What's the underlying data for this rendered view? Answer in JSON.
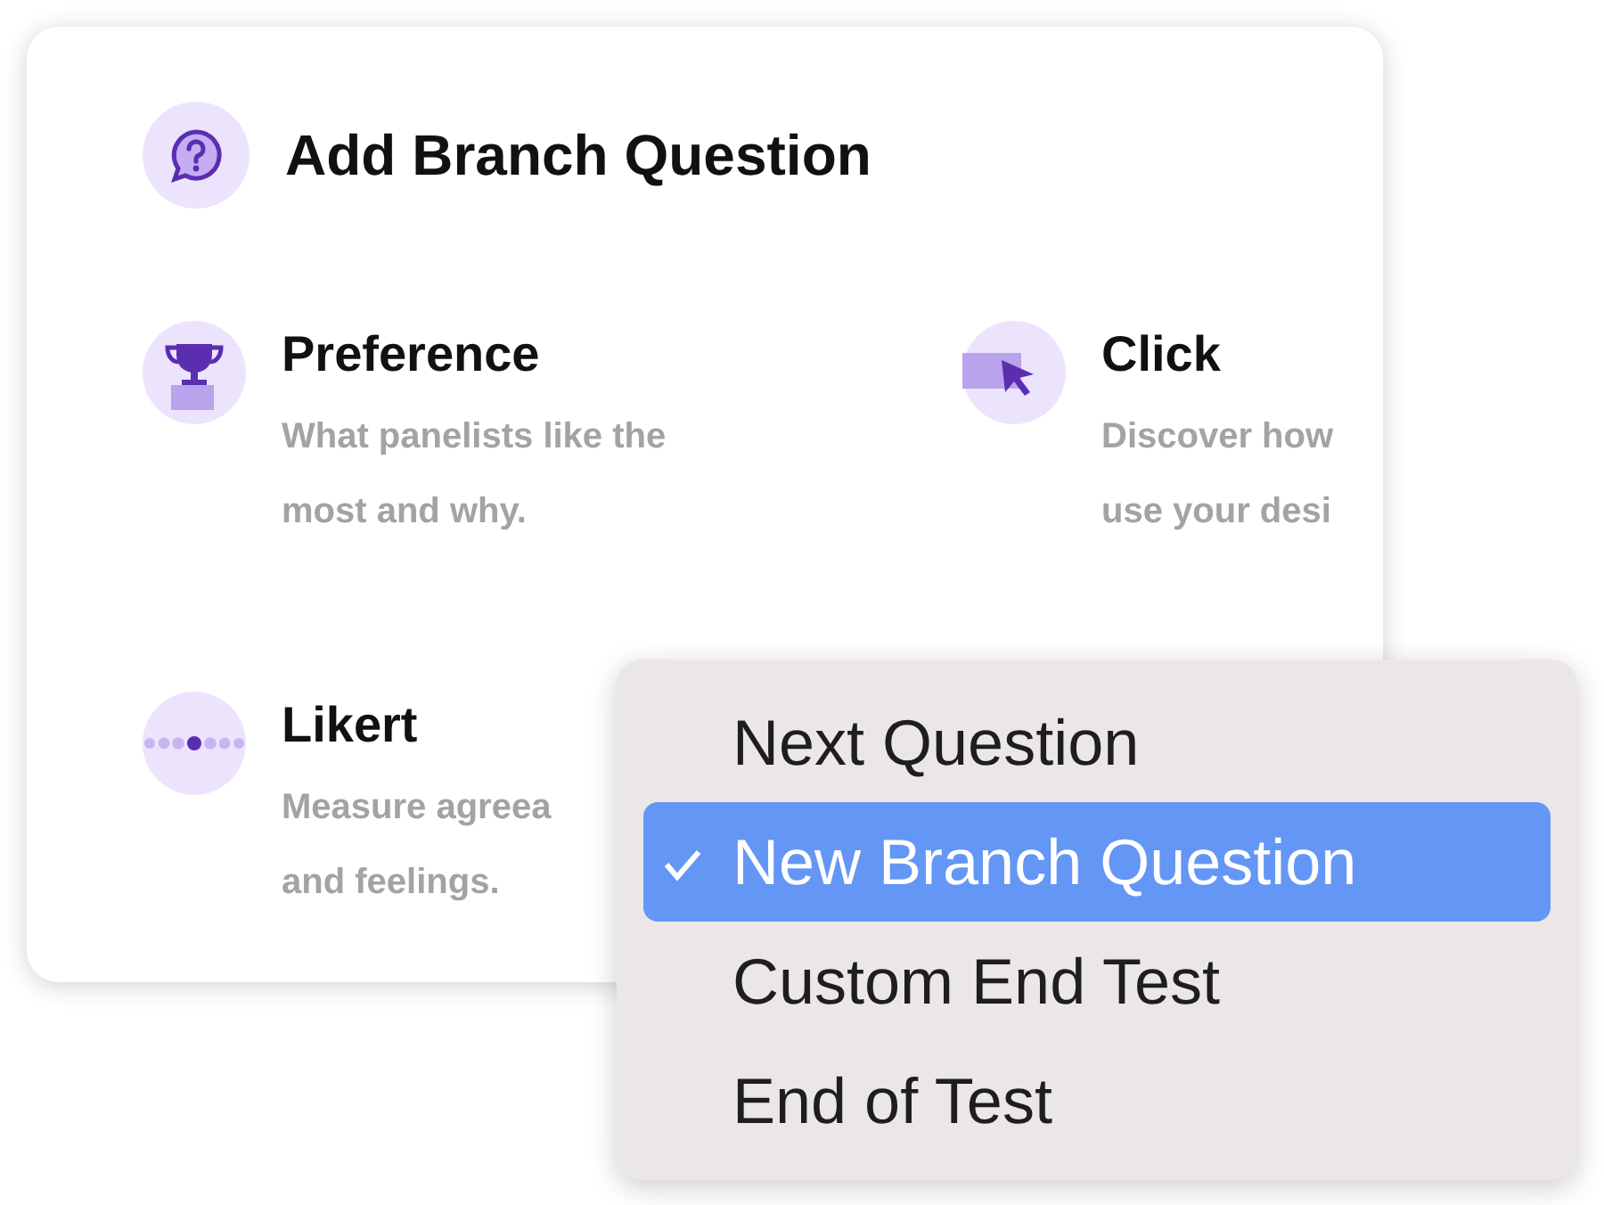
{
  "dialog": {
    "title": "Add Branch Question"
  },
  "question_types": [
    {
      "kind": "preference",
      "title": "Preference",
      "description_lines": [
        "What panelists like the",
        "most and why."
      ]
    },
    {
      "kind": "click",
      "title": "Click",
      "description_lines": [
        "Discover how",
        "use your desi"
      ]
    },
    {
      "kind": "likert",
      "title": "Likert",
      "description_lines": [
        "Measure agreea",
        "and feelings."
      ]
    }
  ],
  "menu": {
    "items": [
      {
        "label": "Next Question",
        "selected": false
      },
      {
        "label": "New Branch Question",
        "selected": true
      },
      {
        "label": "Custom End Test",
        "selected": false
      },
      {
        "label": "End of Test",
        "selected": false
      }
    ]
  }
}
